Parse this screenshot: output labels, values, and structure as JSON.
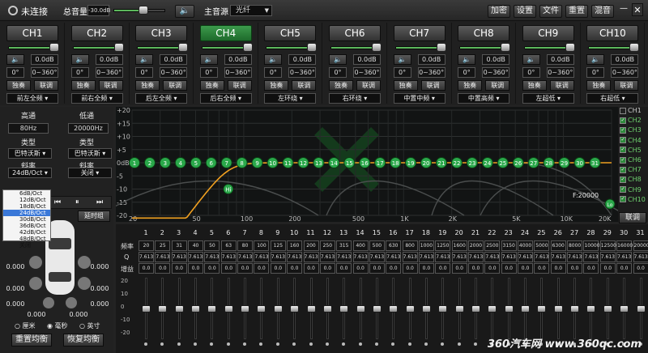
{
  "topbar": {
    "status": "未连接",
    "master_label": "总音量",
    "master_value": "-30.0dB",
    "source_label": "主音源",
    "source_value": "光纤",
    "buttons": [
      "加密",
      "设置",
      "文件",
      "重置",
      "混音"
    ],
    "minimize": "—",
    "close": "✕"
  },
  "channels": [
    {
      "name": "CH1",
      "vol": "0.0dB",
      "phase": "0°",
      "phase_range": "0~360°",
      "solo": "独奏",
      "link": "联调",
      "position": "前左全频",
      "active": false
    },
    {
      "name": "CH2",
      "vol": "0.0dB",
      "phase": "0°",
      "phase_range": "0~360°",
      "solo": "独奏",
      "link": "联调",
      "position": "前右全频",
      "active": false
    },
    {
      "name": "CH3",
      "vol": "0.0dB",
      "phase": "0°",
      "phase_range": "0~360°",
      "solo": "独奏",
      "link": "联调",
      "position": "后左全频",
      "active": false
    },
    {
      "name": "CH4",
      "vol": "0.0dB",
      "phase": "0°",
      "phase_range": "0~360°",
      "solo": "独奏",
      "link": "联调",
      "position": "后右全频",
      "active": true
    },
    {
      "name": "CH5",
      "vol": "0.0dB",
      "phase": "0°",
      "phase_range": "0~360°",
      "solo": "独奏",
      "link": "联调",
      "position": "左环绕",
      "active": false
    },
    {
      "name": "CH6",
      "vol": "0.0dB",
      "phase": "0°",
      "phase_range": "0~360°",
      "solo": "独奏",
      "link": "联调",
      "position": "右环绕",
      "active": false
    },
    {
      "name": "CH7",
      "vol": "0.0dB",
      "phase": "0°",
      "phase_range": "0~360°",
      "solo": "独奏",
      "link": "联调",
      "position": "中置中频",
      "active": false
    },
    {
      "name": "CH8",
      "vol": "0.0dB",
      "phase": "0°",
      "phase_range": "0~360°",
      "solo": "独奏",
      "link": "联调",
      "position": "中置高频",
      "active": false
    },
    {
      "name": "CH9",
      "vol": "0.0dB",
      "phase": "0°",
      "phase_range": "0~360°",
      "solo": "独奏",
      "link": "联调",
      "position": "左超低",
      "active": false
    },
    {
      "name": "CH10",
      "vol": "0.0dB",
      "phase": "0°",
      "phase_range": "0~360°",
      "solo": "独奏",
      "link": "联调",
      "position": "右超低",
      "active": false
    }
  ],
  "filter": {
    "hp_title": "高通",
    "lp_title": "低通",
    "hp_freq": "80Hz",
    "lp_freq": "20000Hz",
    "type_label": "类型",
    "hp_type": "巴特沃斯",
    "lp_type": "巴特沃斯",
    "slope_label": "斜率",
    "hp_slope": "24dB/Oct",
    "lp_slope": "关闭",
    "slope_options": [
      "6dB/Oct",
      "12dB/Oct",
      "18dB/Oct",
      "24dB/Oct",
      "30dB/Oct",
      "36dB/Oct",
      "42dB/Oct",
      "48dB/Oct",
      "关闭"
    ],
    "slope_selected": 3
  },
  "delay": {
    "delay_button": "延时组",
    "speakers": [
      "0.000",
      "0.000",
      "0.000",
      "0.000",
      "0.000",
      "0.000",
      "0.000",
      "0.000"
    ],
    "units": [
      "厘米",
      "毫秒",
      "英寸"
    ],
    "unit_selected": 1,
    "reset_button": "重置均衡",
    "restore_button": "恢复均衡"
  },
  "graph": {
    "y_ticks": [
      "+20",
      "+15",
      "+10",
      "+5",
      "0dB",
      "-5",
      "-10",
      "-15",
      "-20"
    ],
    "x_ticks": [
      "20",
      "50",
      "100",
      "200",
      "500",
      "1K",
      "2K",
      "5K",
      "10K",
      "20K"
    ],
    "points": [
      "1",
      "2",
      "3",
      "4",
      "5",
      "6",
      "7",
      "8",
      "9",
      "10",
      "11",
      "12",
      "13",
      "14",
      "15",
      "16",
      "17",
      "18",
      "19",
      "20",
      "21",
      "22",
      "23",
      "24",
      "25",
      "26",
      "27",
      "28",
      "29",
      "30",
      "31"
    ],
    "hi_marker": "Hi",
    "lo_marker": "Lo",
    "freq_readout": "F:20000",
    "link_button": "联调"
  },
  "channel_checks": [
    {
      "name": "CH1",
      "checked": false
    },
    {
      "name": "CH2",
      "checked": true
    },
    {
      "name": "CH3",
      "checked": true
    },
    {
      "name": "CH4",
      "checked": true
    },
    {
      "name": "CH5",
      "checked": true
    },
    {
      "name": "CH6",
      "checked": true
    },
    {
      "name": "CH7",
      "checked": true
    },
    {
      "name": "CH8",
      "checked": true
    },
    {
      "name": "CH9",
      "checked": true
    },
    {
      "name": "CH10",
      "checked": true
    }
  ],
  "eq": {
    "freq_label": "频率",
    "q_label": "Q",
    "gain_label": "增益",
    "bands": [
      "1",
      "2",
      "3",
      "4",
      "5",
      "6",
      "7",
      "8",
      "9",
      "10",
      "11",
      "12",
      "13",
      "14",
      "15",
      "16",
      "17",
      "18",
      "19",
      "20",
      "21",
      "22",
      "23",
      "24",
      "25",
      "26",
      "27",
      "28",
      "29",
      "30",
      "31"
    ],
    "freqs": [
      "20",
      "25",
      "31",
      "40",
      "50",
      "63",
      "80",
      "100",
      "125",
      "160",
      "200",
      "250",
      "315",
      "400",
      "500",
      "630",
      "800",
      "1000",
      "1250",
      "1600",
      "2000",
      "2500",
      "3150",
      "4000",
      "5000",
      "6300",
      "8000",
      "10000",
      "12500",
      "16000",
      "20000"
    ],
    "q": "7.613",
    "gain": "0.0",
    "scale": [
      "20",
      "10",
      "0",
      "-10",
      "-20"
    ]
  },
  "watermark": "360汽车网 www.360qc.com"
}
